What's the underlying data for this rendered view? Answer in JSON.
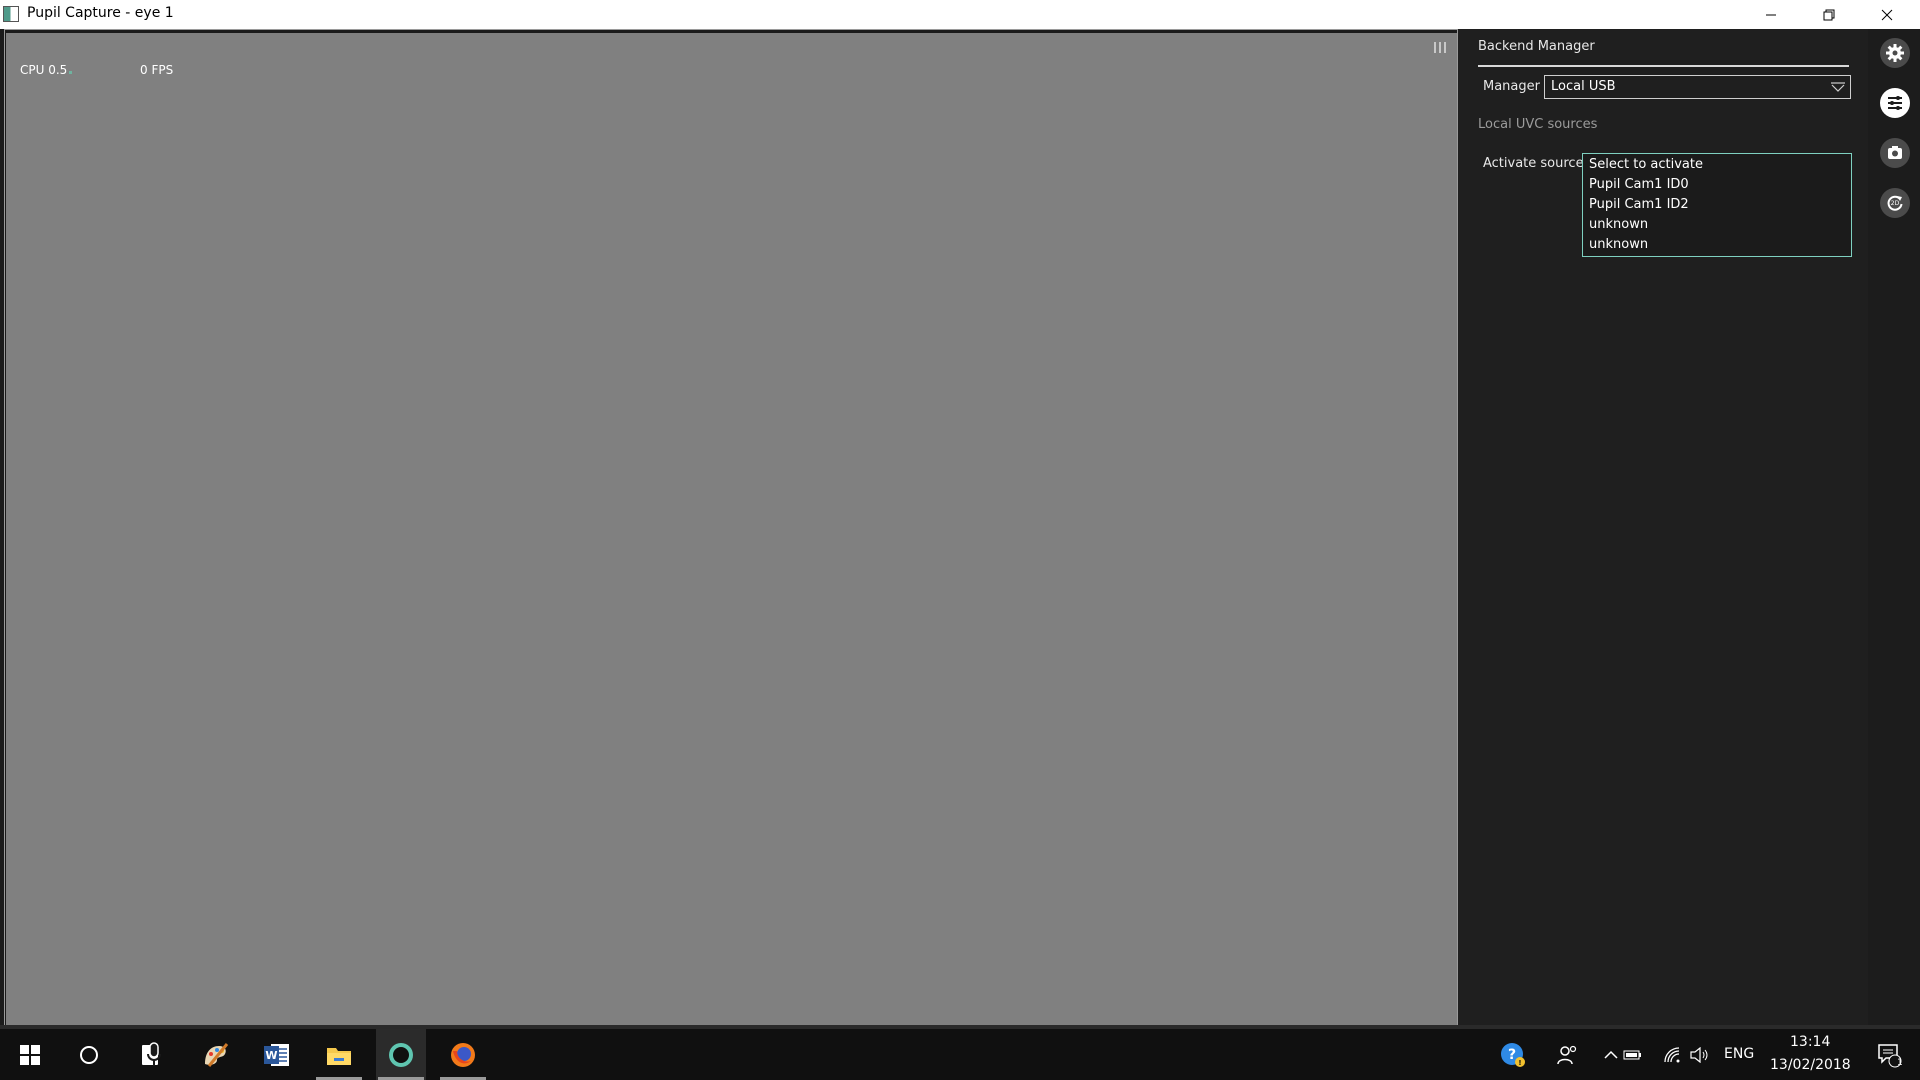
{
  "window": {
    "title": "Pupil Capture - eye 1"
  },
  "status": {
    "cpu_label": "CPU 0.5",
    "fps_label": "0 FPS"
  },
  "panel": {
    "title": "Backend Manager",
    "manager_label": "Manager",
    "manager_value": "Local USB",
    "section_label": "Local UVC sources",
    "activate_label": "Activate source",
    "sources": [
      "Select to activate",
      "Pupil Cam1 ID0",
      "Pupil Cam1 ID2",
      "unknown",
      "unknown"
    ]
  },
  "iconbar": {
    "items": [
      "gear-icon",
      "list-icon",
      "camera-icon",
      "refresh-icon"
    ]
  },
  "taskbar": {
    "apps": [
      "windows-start-icon",
      "cortana-icon",
      "microphone-app-icon",
      "paint-app-icon",
      "word-icon",
      "file-explorer-icon",
      "pupil-capture-icon",
      "firefox-icon"
    ],
    "language": "ENG",
    "time": "13:14",
    "date": "13/02/2018",
    "notification_count": "1"
  },
  "colors": {
    "canvas": "#808080",
    "panel": "#1f1f1f",
    "accent": "#7ed0c0"
  }
}
